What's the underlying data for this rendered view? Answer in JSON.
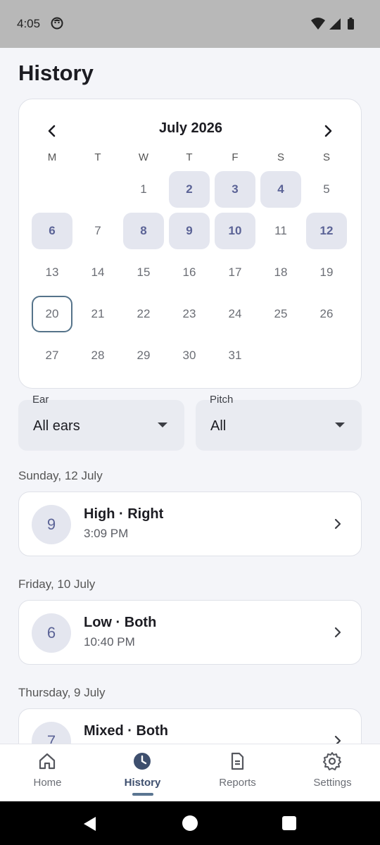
{
  "status_bar": {
    "time": "4:05"
  },
  "page": {
    "title": "History"
  },
  "calendar": {
    "month_label": "July 2026",
    "weekdays": [
      "M",
      "T",
      "W",
      "T",
      "F",
      "S",
      "S"
    ],
    "days": [
      {
        "label": "1",
        "state": "plain"
      },
      {
        "label": "2",
        "state": "has-entry"
      },
      {
        "label": "3",
        "state": "has-entry"
      },
      {
        "label": "4",
        "state": "has-entry"
      },
      {
        "label": "5",
        "state": "plain"
      },
      {
        "label": "6",
        "state": "has-entry"
      },
      {
        "label": "7",
        "state": "plain"
      },
      {
        "label": "8",
        "state": "has-entry"
      },
      {
        "label": "9",
        "state": "has-entry"
      },
      {
        "label": "10",
        "state": "has-entry"
      },
      {
        "label": "11",
        "state": "plain"
      },
      {
        "label": "12",
        "state": "has-entry"
      },
      {
        "label": "13",
        "state": "plain"
      },
      {
        "label": "14",
        "state": "plain"
      },
      {
        "label": "15",
        "state": "plain"
      },
      {
        "label": "16",
        "state": "plain"
      },
      {
        "label": "17",
        "state": "plain"
      },
      {
        "label": "18",
        "state": "plain"
      },
      {
        "label": "19",
        "state": "plain"
      },
      {
        "label": "20",
        "state": "today"
      },
      {
        "label": "21",
        "state": "plain"
      },
      {
        "label": "22",
        "state": "plain"
      },
      {
        "label": "23",
        "state": "plain"
      },
      {
        "label": "24",
        "state": "plain"
      },
      {
        "label": "25",
        "state": "plain"
      },
      {
        "label": "26",
        "state": "plain"
      },
      {
        "label": "27",
        "state": "plain"
      },
      {
        "label": "28",
        "state": "plain"
      },
      {
        "label": "29",
        "state": "plain"
      },
      {
        "label": "30",
        "state": "plain"
      },
      {
        "label": "31",
        "state": "plain"
      }
    ]
  },
  "filters": {
    "ear": {
      "label": "Ear",
      "value": "All ears"
    },
    "pitch": {
      "label": "Pitch",
      "value": "All"
    }
  },
  "history": [
    {
      "date": "Sunday, 12 July",
      "score": "9",
      "title": "High · Right",
      "time": "3:09 PM"
    },
    {
      "date": "Friday, 10 July",
      "score": "6",
      "title": "Low · Both",
      "time": "10:40 PM"
    },
    {
      "date": "Thursday, 9 July",
      "score": "7",
      "title": "Mixed · Both",
      "time": ""
    }
  ],
  "bottom_nav": {
    "items": [
      {
        "label": "Home",
        "icon": "home-icon"
      },
      {
        "label": "History",
        "icon": "clock-icon",
        "active": true
      },
      {
        "label": "Reports",
        "icon": "document-icon"
      },
      {
        "label": "Settings",
        "icon": "gear-icon"
      }
    ]
  },
  "colors": {
    "accent": "#5b6396",
    "entry_bg": "#e4e6ef",
    "today_border": "#55738a",
    "active_nav": "#3e4f6e"
  }
}
